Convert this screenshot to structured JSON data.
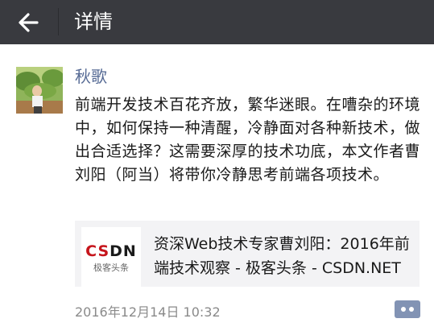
{
  "header": {
    "title": "详情",
    "back_icon": "arrow-left-icon"
  },
  "post": {
    "author": "秋歌",
    "text": "前端开发技术百花齐放，繁华迷眼。在嘈杂的环境中，如何保持一种清醒，冷静面对各种新技术，做出合适选择？这需要深厚的技术功底，本文作者曹刘阳（阿当）将带你冷静思考前端各项技术。",
    "link_card": {
      "title": "资深Web技术专家曹刘阳：2016年前端技术观察 - 极客头条 - CSDN.NET",
      "thumb_logo_part1": "CS",
      "thumb_logo_part2": "DN",
      "thumb_sub": "极客头条"
    },
    "timestamp": "2016年12月14日 10:32",
    "comment_icon": "comment-dots-icon"
  },
  "colors": {
    "top_bar": "#393a3f",
    "author_link": "#576b95",
    "comment_button": "#8293b4",
    "csdn_red": "#c6151c"
  }
}
